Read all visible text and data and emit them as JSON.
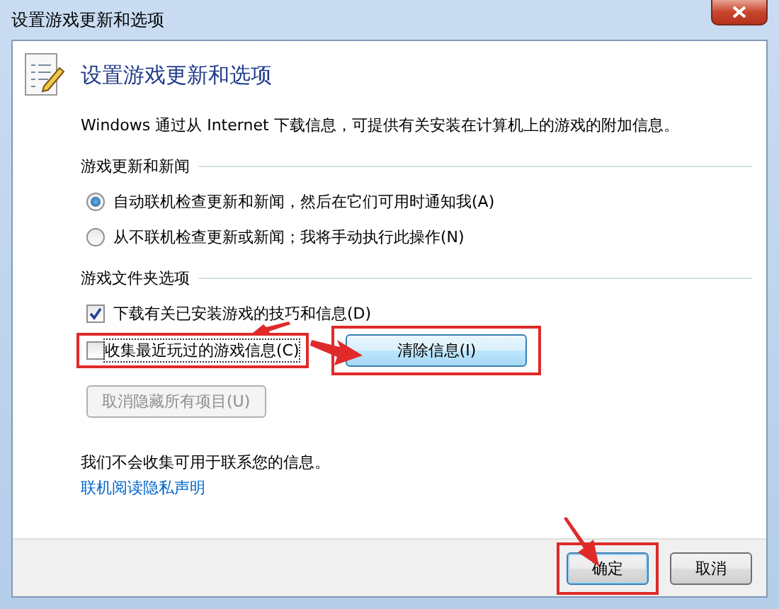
{
  "window": {
    "title": "设置游戏更新和选项"
  },
  "header": {
    "title": "设置游戏更新和选项",
    "description": "Windows 通过从 Internet 下载信息，可提供有关安装在计算机上的游戏的附加信息。"
  },
  "groups": [
    {
      "title": "游戏更新和新闻",
      "options": [
        {
          "kind": "radio",
          "label": "自动联机检查更新和新闻，然后在它们可用时通知我(A)",
          "selected": true,
          "highlighted": false
        },
        {
          "kind": "radio",
          "label": "从不联机检查更新或新闻；我将手动执行此操作(N)",
          "selected": false,
          "highlighted": false
        }
      ]
    },
    {
      "title": "游戏文件夹选项",
      "options": [
        {
          "kind": "checkbox",
          "label": "下载有关已安装游戏的技巧和信息(D)",
          "checked": true,
          "highlighted": false
        },
        {
          "kind": "checkbox",
          "label": "收集最近玩过的游戏信息(C)",
          "checked": false,
          "highlighted": true,
          "button": {
            "label": "清除信息(I)",
            "disabled": false,
            "highlighted": true
          }
        }
      ],
      "buttons": [
        {
          "label": "取消隐藏所有项目(U)",
          "disabled": true
        }
      ]
    }
  ],
  "privacy": {
    "note": "我们不会收集可用于联系您的信息。",
    "link": "联机阅读隐私声明"
  },
  "footer_buttons": [
    {
      "label": "确定",
      "default": true,
      "highlighted": true
    },
    {
      "label": "取消",
      "default": false,
      "highlighted": false
    }
  ]
}
